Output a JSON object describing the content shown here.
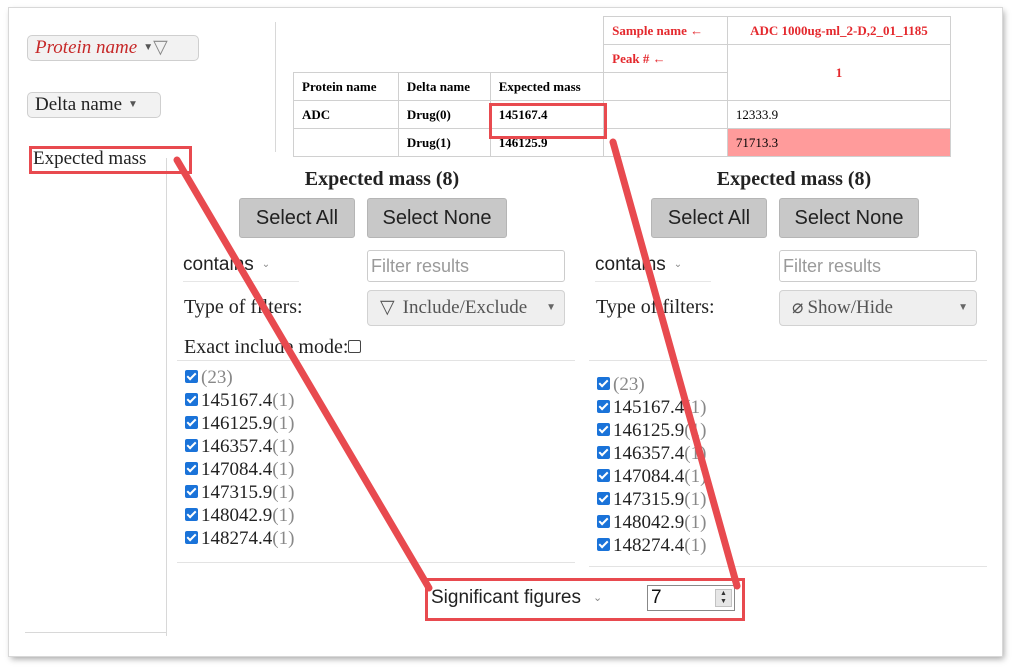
{
  "filters": {
    "protein_name": "Protein name",
    "delta_name": "Delta name",
    "expected_mass": "Expected mass"
  },
  "pivot": {
    "sample_name_label": "Sample name ←",
    "sample_name_value": "ADC 1000ug-ml_2-D,2_01_1185",
    "peak_label": "Peak # ←",
    "peak_value": "1",
    "col_headers": [
      "Protein name",
      "Delta name",
      "Expected mass"
    ],
    "rows": [
      {
        "protein": "ADC",
        "delta": "Drug(0)",
        "mass": "145167.4",
        "value": "12333.9"
      },
      {
        "protein": "",
        "delta": "Drug(1)",
        "mass": "146125.9",
        "value": "71713.3"
      }
    ]
  },
  "panels": [
    {
      "title": "Expected mass (8)",
      "select_all": "Select All",
      "select_none": "Select None",
      "operator": "contains",
      "filter_placeholder": "Filter results",
      "type_label": "Type of filters:",
      "type_value": "Include/Exclude",
      "exact_label": "Exact include mode:",
      "items": [
        {
          "value": "",
          "count": "(23)"
        },
        {
          "value": "145167.4",
          "count": "(1)"
        },
        {
          "value": "146125.9",
          "count": "(1)"
        },
        {
          "value": "146357.4",
          "count": "(1)"
        },
        {
          "value": "147084.4",
          "count": "(1)"
        },
        {
          "value": "147315.9",
          "count": "(1)"
        },
        {
          "value": "148042.9",
          "count": "(1)"
        },
        {
          "value": "148274.4",
          "count": "(1)"
        }
      ]
    },
    {
      "title": "Expected mass (8)",
      "select_all": "Select All",
      "select_none": "Select None",
      "operator": "contains",
      "filter_placeholder": "Filter results",
      "type_label": "Type of filters:",
      "type_value": "Show/Hide",
      "items": [
        {
          "value": "",
          "count": "(23)"
        },
        {
          "value": "145167.4",
          "count": "(1)"
        },
        {
          "value": "146125.9",
          "count": "(1)"
        },
        {
          "value": "146357.4",
          "count": "(1)"
        },
        {
          "value": "147084.4",
          "count": "(1)"
        },
        {
          "value": "147315.9",
          "count": "(1)"
        },
        {
          "value": "148042.9",
          "count": "(1)"
        },
        {
          "value": "148274.4",
          "count": "(1)"
        }
      ]
    }
  ],
  "sigfig": {
    "label": "Significant figures",
    "value": "7"
  },
  "colors": {
    "accent_red": "#e84a4f",
    "header_red": "#e4292e",
    "highlight_cell": "#ff9b9b",
    "checkbox_blue": "#1a73d9"
  }
}
